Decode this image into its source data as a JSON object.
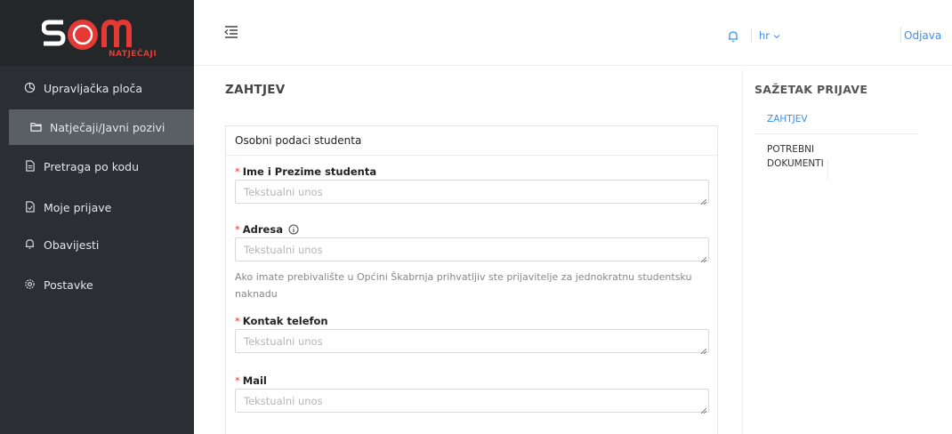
{
  "app": {
    "logo_subtitle": "NATJEČAJI",
    "brand_color": "#e53935",
    "accent_color": "#3f8fe8",
    "sidebar_color": "#2b2f33"
  },
  "sidebar": {
    "items": [
      {
        "label": "Upravljačka ploča",
        "icon": "dashboard-icon"
      },
      {
        "label": "Natječaji/Javni pozivi",
        "icon": "folder-icon",
        "active": true
      },
      {
        "label": "Pretraga po kodu",
        "icon": "document-search-icon"
      },
      {
        "label": "Moje prijave",
        "icon": "document-icon"
      },
      {
        "label": "Obavijesti",
        "icon": "bell-icon"
      },
      {
        "label": "Postavke",
        "icon": "gear-icon"
      }
    ]
  },
  "header": {
    "language": "hr",
    "logout": "Odjava"
  },
  "main": {
    "title": "ZAHTJEV",
    "section_title": "Osobni podaci studenta",
    "fields": [
      {
        "label": "Ime i Prezime studenta",
        "placeholder": "Tekstualni unos",
        "required": true
      },
      {
        "label": "Adresa",
        "placeholder": "Tekstualni unos",
        "required": true,
        "info": true,
        "hint": "Ako imate prebivalište u Općini Škabrnja prihvatljiv ste prijavitelje za jednokratnu studentsku naknadu"
      },
      {
        "label": "Kontak telefon",
        "placeholder": "Tekstualni unos",
        "required": true
      },
      {
        "label": "Mail",
        "placeholder": "Tekstualni unos",
        "required": true
      }
    ]
  },
  "summary": {
    "title": "SAŽETAK PRIJAVE",
    "items": [
      {
        "label": "ZAHTJEV",
        "active": true
      },
      {
        "label_line1": "POTREBNI",
        "label_line2": "DOKUMENTI"
      }
    ]
  }
}
